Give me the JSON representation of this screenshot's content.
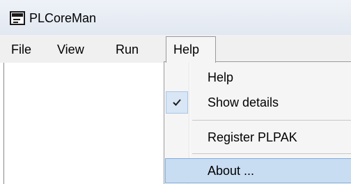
{
  "window": {
    "title": "PLCoreMan"
  },
  "menubar": {
    "items": [
      {
        "label": "File"
      },
      {
        "label": "View"
      },
      {
        "label": "Run"
      },
      {
        "label": "Help"
      }
    ]
  },
  "help_menu": {
    "items": [
      {
        "label": "Help",
        "checked": false
      },
      {
        "label": "Show details",
        "checked": true
      },
      {
        "label": "Register PLPAK",
        "checked": false
      },
      {
        "label": "About ...",
        "checked": false,
        "highlighted": true
      }
    ]
  },
  "colors": {
    "highlight": "#c8ddf2",
    "highlight_border": "#84acdd",
    "menu_bg": "#f5f5f5",
    "menubar_bg": "#f0f0f0"
  },
  "icons": {
    "app": "window-app-icon",
    "check": "checkmark-icon"
  }
}
